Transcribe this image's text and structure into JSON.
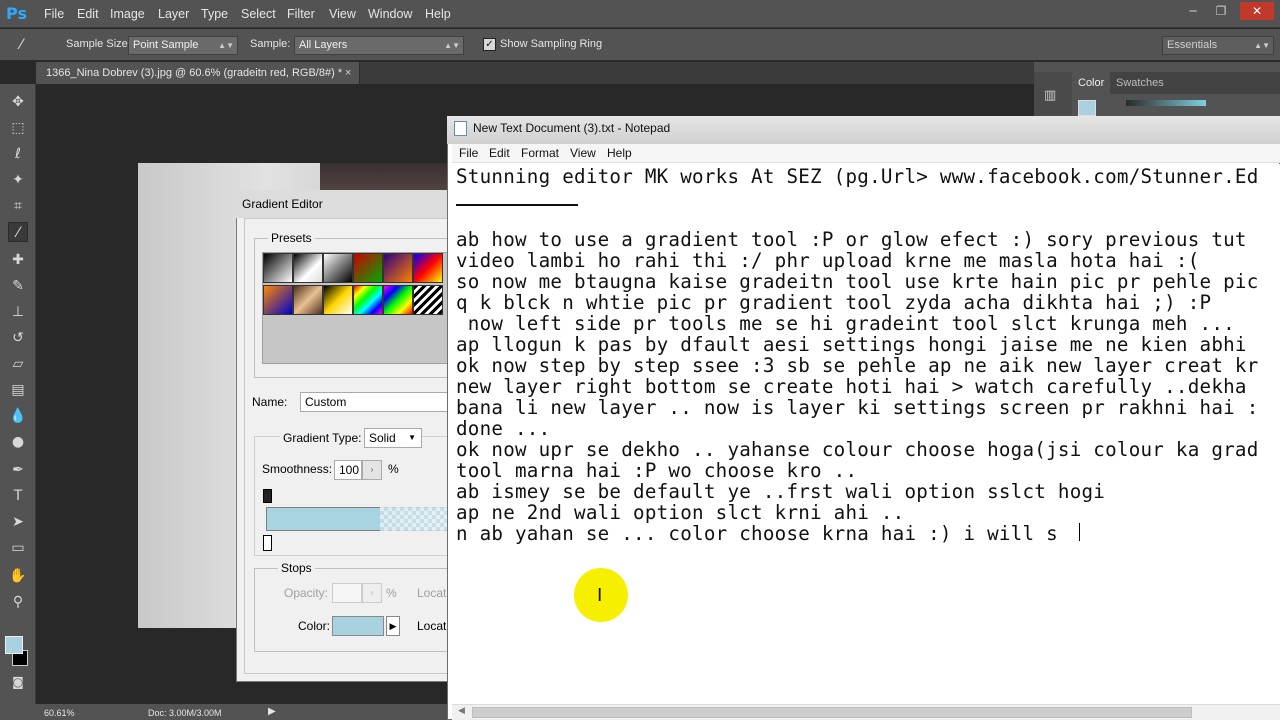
{
  "photoshop": {
    "logo": "Ps",
    "menu": [
      "File",
      "Edit",
      "Image",
      "Layer",
      "Type",
      "Select",
      "Filter",
      "View",
      "Window",
      "Help"
    ],
    "window_controls": {
      "minimize": "─",
      "restore": "❐",
      "close": "✕"
    },
    "options": {
      "tool_icon": "eyedropper-icon",
      "sample_size_label": "Sample Size:",
      "sample_size_value": "Point Sample",
      "sample_label": "Sample:",
      "sample_value": "All Layers",
      "show_ring_label": "Show Sampling Ring",
      "show_ring_checked": true,
      "workspace_value": "Essentials"
    },
    "doc_tab": {
      "title": "1366_Nina Dobrev (3).jpg @ 60.6% (gradeitn red, RGB/8#) *",
      "close": "×"
    },
    "panel_tabs": [
      "Color",
      "Swatches"
    ],
    "status": {
      "zoom": "60.61%",
      "doc": "Doc: 3.00M/3.00M"
    },
    "tools": [
      "move-icon",
      "marquee-icon",
      "lasso-icon",
      "magic-wand-icon",
      "crop-icon",
      "eyedropper-icon",
      "healing-icon",
      "brush-icon",
      "stamp-icon",
      "history-brush-icon",
      "eraser-icon",
      "gradient-icon",
      "blur-icon",
      "dodge-icon",
      "pen-icon",
      "type-icon",
      "path-select-icon",
      "shape-icon",
      "hand-icon",
      "zoom-icon"
    ],
    "colors": {
      "foreground": "#a8d2e0",
      "background": "#000000",
      "accent": "#31a8ff"
    }
  },
  "gradient_editor": {
    "title": "Gradient Editor",
    "presets_label": "Presets",
    "name_label": "Name:",
    "name_value": "Custom",
    "type_label": "Gradient Type:",
    "type_value": "Solid",
    "smoothness_label": "Smoothness:",
    "smoothness_value": "100",
    "smoothness_unit": "%",
    "stops_label": "Stops",
    "opacity_label": "Opacity:",
    "opacity_unit": "%",
    "location_label": "Locat",
    "color_label": "Color:",
    "stop_color": "#a8d2e0"
  },
  "notepad": {
    "title": "New Text Document (3).txt - Notepad",
    "menu": [
      "File",
      "Edit",
      "Format",
      "View",
      "Help"
    ],
    "lines": [
      "Stunning editor MK works At SEZ (pg.Url> www.facebook.com/Stunner.Ed",
      "",
      "",
      "ab how to use a gradient tool :P or glow efect :) sory previous tut",
      "video lambi ho rahi thi :/ phr upload krne me masla hota hai :(",
      "so now me btaugna kaise gradeitn tool use krte hain pic pr pehle pic",
      "q k blck n whtie pic pr gradient tool zyda acha dikhta hai ;) :P",
      " now left side pr tools me se hi gradeint tool slct krunga meh ...",
      "ap llogun k pas by dfault aesi settings hongi jaise me ne kien abhi",
      "ok now step by step ssee :3 sb se pehle ap ne aik new layer creat kr",
      "new layer right bottom se create hoti hai > watch carefully ..dekha",
      "bana li new layer .. now is layer ki settings screen pr rakhni hai :",
      "done ...",
      "ok now upr se dekho .. yahanse colour choose hoga(jsi colour ka grad",
      "tool marna hai :P wo choose kro ..",
      "ab ismey se be default ye ..frst wali option sslct hogi",
      "ap ne 2nd wali option slct krni ahi ..",
      "n ab yahan se ... color choose krna hai :) i will s"
    ],
    "cursor_icon": "ibeam-cursor-icon",
    "highlight_color": "#f6f000"
  }
}
